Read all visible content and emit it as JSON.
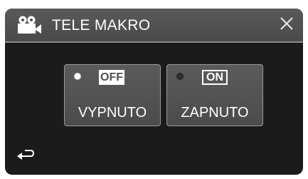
{
  "header": {
    "title": "TELE MAKRO",
    "mode_icon": "video-camera-icon",
    "close_icon": "close-icon"
  },
  "options": [
    {
      "badge": "OFF",
      "label": "VYPNUTO",
      "selected": true
    },
    {
      "badge": "ON",
      "label": "ZAPNUTO",
      "selected": false
    }
  ],
  "footer": {
    "back_icon": "return-arrow-icon"
  },
  "colors": {
    "screen_bg": "#1b1b1b",
    "header_bg": "#555555",
    "button_bg": "#555555",
    "text": "#ffffff"
  }
}
